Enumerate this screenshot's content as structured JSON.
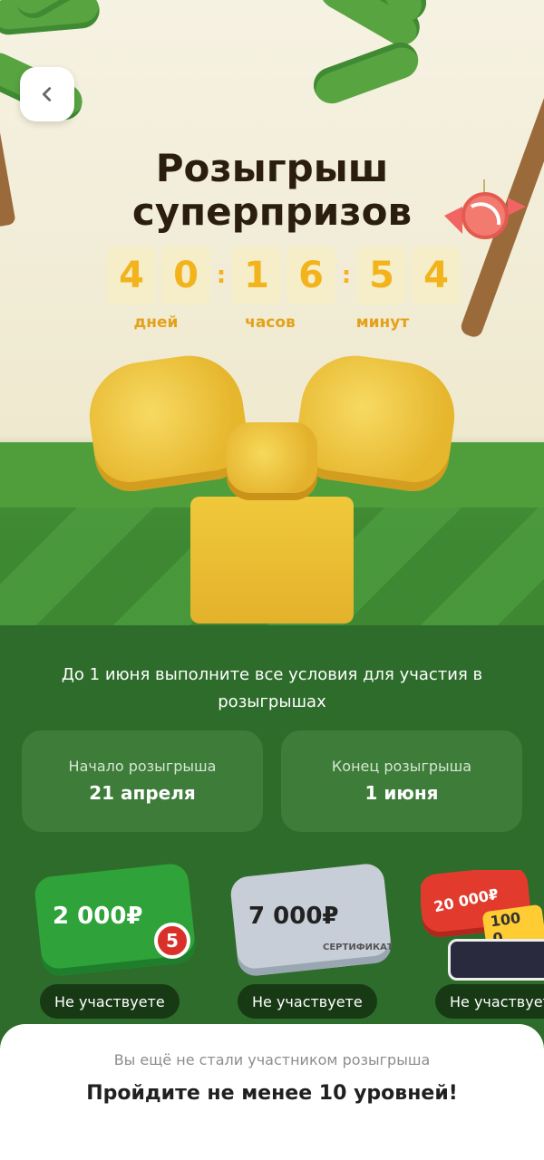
{
  "header": {
    "title_line1": "Розыгрыш",
    "title_line2": "суперпризов"
  },
  "countdown": {
    "digits": [
      "4",
      "0",
      "1",
      "6",
      "5",
      "4"
    ],
    "labels": [
      "дней",
      "часов",
      "минут"
    ]
  },
  "description": "До 1 июня выполните все условия для участия в розыгрышах",
  "info": {
    "start_label": "Начало розыгрыша",
    "start_value": "21 апреля",
    "end_label": "Конец розыгрыша",
    "end_value": "1 июня"
  },
  "prizes": [
    {
      "amount": "2 000₽",
      "status": "Не участвуете",
      "color": "#2f9b39"
    },
    {
      "amount": "7 000₽",
      "status": "Не участвуете",
      "color": "#c7ced7",
      "subtitle": "СЕРТИФИКАТ"
    },
    {
      "amount": "20 000₽",
      "status": "Не участвуете",
      "color": "#e23b2e",
      "extra": "100 0"
    }
  ],
  "bottom_sheet": {
    "subtitle": "Вы ещё не стали участником розыгрыша",
    "title": "Пройдите не менее 10 уровней!"
  },
  "colors": {
    "accent": "#f2b31c",
    "green": "#2d6c2b",
    "dark_badge": "#173a15"
  },
  "icons": {
    "back": "chevron-left-icon",
    "candy": "candy-icon",
    "palm": "palm-tree-icon",
    "pyaterochka": "pyaterochka-logo-icon"
  }
}
